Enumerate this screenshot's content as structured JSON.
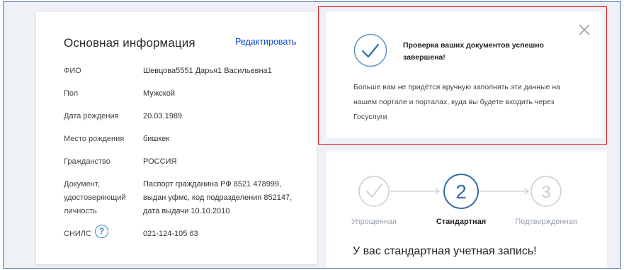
{
  "basic_info": {
    "title": "Основная информация",
    "edit_label": "Редактировать",
    "rows": [
      {
        "label": "ФИО",
        "value": "Шевцова5551 Дарья1 Васильевна1"
      },
      {
        "label": "Пол",
        "value": "Мужской"
      },
      {
        "label": "Дата рождения",
        "value": "20.03.1989"
      },
      {
        "label": "Место рождения",
        "value": "бишкек"
      },
      {
        "label": "Гражданство",
        "value": "РОССИЯ"
      },
      {
        "label_lines": [
          "Документ,",
          "удостоверяющий",
          "личность"
        ],
        "value_lines": [
          "Паспорт гражданина РФ 8521 478999,",
          "выдан уфмс, код подразделения 852147,",
          "дата выдачи 10.10.2010"
        ]
      },
      {
        "label": "СНИЛС",
        "value": "021-124-105 63",
        "help_icon": "?"
      }
    ]
  },
  "notification": {
    "headline_lines": [
      "Проверка ваших документов успешно",
      "завершена!"
    ],
    "body_lines": [
      "Больше вам не придётся вручную заполнять эти данные на",
      "нашем портале и порталах, куда вы будете входить через",
      "Госуслуги"
    ],
    "highlight_color": "#d61a1a"
  },
  "account_levels": {
    "steps": [
      {
        "label": "Упрощенная",
        "number": "",
        "state": "done"
      },
      {
        "label": "Стандартная",
        "number": "2",
        "state": "current"
      },
      {
        "label": "Подтвержденная",
        "number": "3",
        "state": "pending"
      }
    ],
    "status_text": "У вас стандартная учетная запись!"
  },
  "colors": {
    "accent": "#0d4cd3",
    "step_blue": "#2d6ea8",
    "muted": "#c9ced6"
  }
}
